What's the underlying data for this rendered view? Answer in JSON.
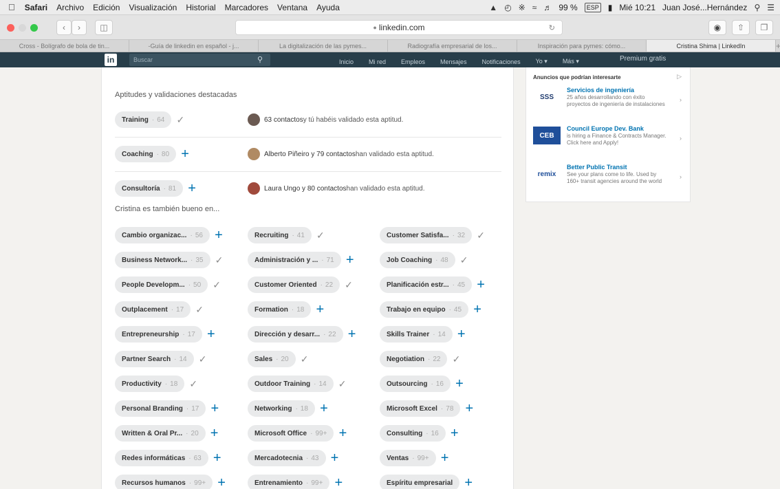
{
  "menubar": {
    "items": [
      "Safari",
      "Archivo",
      "Edición",
      "Visualización",
      "Historial",
      "Marcadores",
      "Ventana",
      "Ayuda"
    ],
    "battery": "99 %",
    "input_lang": "ESP",
    "datetime": "Mié 10:21",
    "user": "Juan José...Hernández"
  },
  "browser": {
    "url": "linkedin.com",
    "tabs": [
      "Cross - Bolígrafo de bola de tin...",
      "-Guía de linkedin en español - j...",
      "La digitalización de las pymes...",
      "Radiografía empresarial de los...",
      "Inspiración para pymes: cómo...",
      "Cristina Shima | LinkedIn"
    ]
  },
  "linkedin_nav": {
    "logo": "in",
    "search_placeholder": "Buscar",
    "items": [
      "Inicio",
      "Mi red",
      "Empleos",
      "Mensajes",
      "Notificaciones",
      "Yo ▾",
      "Más ▾"
    ],
    "premium": "Premium gratis"
  },
  "skills_section": {
    "title": "Aptitudes y validaciones destacadas",
    "featured": [
      {
        "name": "Training",
        "count": "64",
        "state": "check",
        "avatar_color": "#6b5a52",
        "endorse_bold": "63 contactos",
        "endorse_text": " y tú habéis validado esta aptitud."
      },
      {
        "name": "Coaching",
        "count": "80",
        "state": "plus",
        "avatar_color": "#b08a63",
        "endorse_bold": "Alberto Piñeiro y 79 contactos",
        "endorse_text": " han validado esta aptitud."
      },
      {
        "name": "Consultoría",
        "count": "81",
        "state": "plus",
        "avatar_color": "#a04a3c",
        "endorse_bold": "Laura Ungo y 80 contactos",
        "endorse_text": " han validado esta aptitud."
      }
    ],
    "also_title": "Cristina es también bueno en...",
    "also": [
      [
        {
          "name": "Cambio organizac...",
          "count": "56",
          "state": "plus"
        },
        {
          "name": "Recruiting",
          "count": "41",
          "state": "check"
        },
        {
          "name": "Customer Satisfa...",
          "count": "32",
          "state": "check"
        }
      ],
      [
        {
          "name": "Business Network...",
          "count": "35",
          "state": "check"
        },
        {
          "name": "Administración y ...",
          "count": "71",
          "state": "plus"
        },
        {
          "name": "Job Coaching",
          "count": "48",
          "state": "check"
        }
      ],
      [
        {
          "name": "People Developm...",
          "count": "50",
          "state": "check"
        },
        {
          "name": "Customer Oriented",
          "count": "22",
          "state": "check"
        },
        {
          "name": "Planificación estr...",
          "count": "45",
          "state": "plus"
        }
      ],
      [
        {
          "name": "Outplacement",
          "count": "17",
          "state": "check"
        },
        {
          "name": "Formation",
          "count": "18",
          "state": "plus"
        },
        {
          "name": "Trabajo en equipo",
          "count": "45",
          "state": "plus"
        }
      ],
      [
        {
          "name": "Entrepreneurship",
          "count": "17",
          "state": "plus"
        },
        {
          "name": "Dirección y desarr...",
          "count": "22",
          "state": "plus"
        },
        {
          "name": "Skills Trainer",
          "count": "14",
          "state": "plus"
        }
      ],
      [
        {
          "name": "Partner Search",
          "count": "14",
          "state": "check"
        },
        {
          "name": "Sales",
          "count": "20",
          "state": "check"
        },
        {
          "name": "Negotiation",
          "count": "22",
          "state": "check"
        }
      ],
      [
        {
          "name": "Productivity",
          "count": "18",
          "state": "check"
        },
        {
          "name": "Outdoor Training",
          "count": "14",
          "state": "check"
        },
        {
          "name": "Outsourcing",
          "count": "16",
          "state": "plus"
        }
      ],
      [
        {
          "name": "Personal Branding",
          "count": "17",
          "state": "plus"
        },
        {
          "name": "Networking",
          "count": "18",
          "state": "plus"
        },
        {
          "name": "Microsoft Excel",
          "count": "78",
          "state": "plus"
        }
      ],
      [
        {
          "name": "Written & Oral Pr...",
          "count": "20",
          "state": "plus"
        },
        {
          "name": "Microsoft Office",
          "count": "99+",
          "state": "plus"
        },
        {
          "name": "Consulting",
          "count": "16",
          "state": "plus"
        }
      ],
      [
        {
          "name": "Redes informáticas",
          "count": "63",
          "state": "plus"
        },
        {
          "name": "Mercadotecnia",
          "count": "43",
          "state": "plus"
        },
        {
          "name": "Ventas",
          "count": "99+",
          "state": "plus"
        }
      ],
      [
        {
          "name": "Recursos humanos",
          "count": "99+",
          "state": "plus"
        },
        {
          "name": "Entrenamiento",
          "count": "99+",
          "state": "plus"
        },
        {
          "name": "Espíritu empresarial",
          "count": "",
          "state": "plus"
        }
      ]
    ]
  },
  "ads": {
    "title": "Anuncios que podrían interesarte",
    "items": [
      {
        "logo": "SSS",
        "logo_color": "#1e3a6e",
        "title": "Servicios de ingeniería",
        "desc": "25 años desarrollando con éxito proyectos de ingeniería de instalaciones"
      },
      {
        "logo": "CEB",
        "logo_color": "#ffffff",
        "logo_bg": "#1f4f9a",
        "title": "Council Europe Dev. Bank",
        "desc": "is hiring a Finance & Contracts Manager. Click here and Apply!"
      },
      {
        "logo": "remix",
        "logo_color": "#1f4f9a",
        "title": "Better Public Transit",
        "desc": "See your plans come to life. Used by 160+ transit agencies around the world"
      }
    ]
  }
}
